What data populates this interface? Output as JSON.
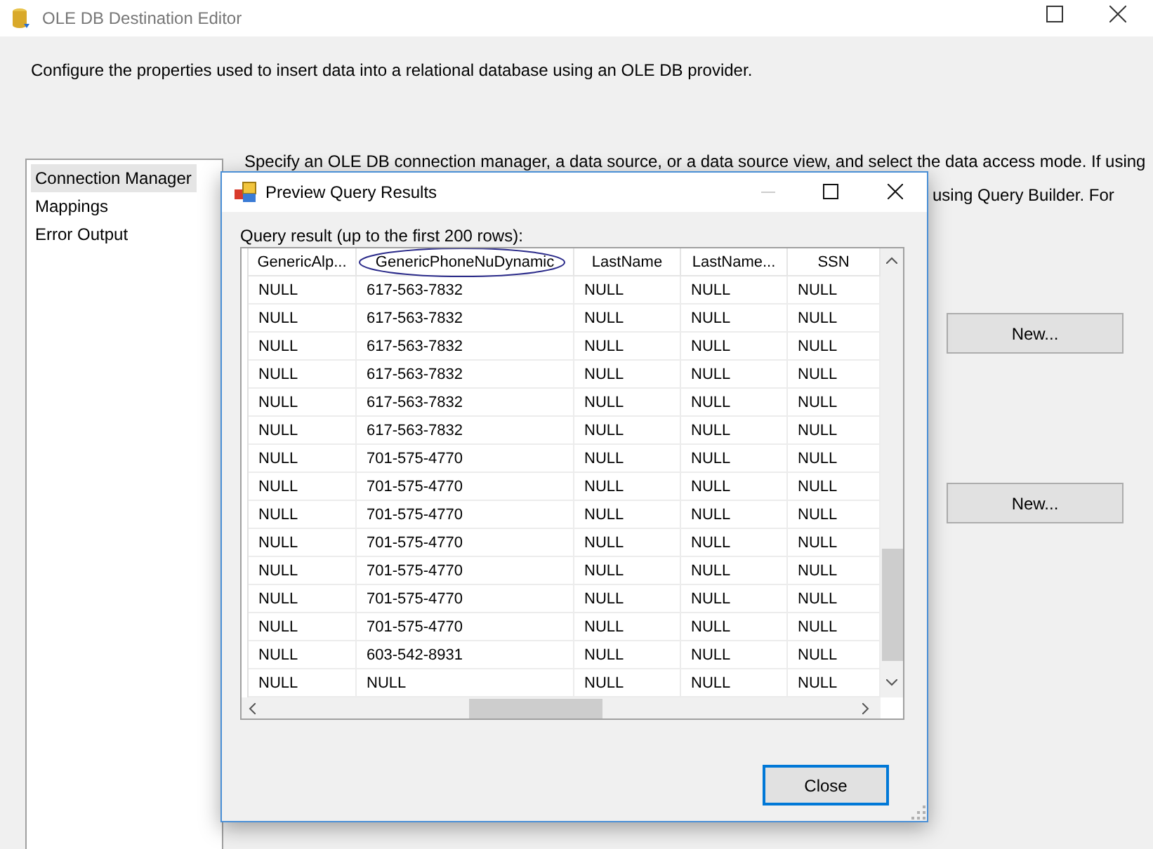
{
  "window": {
    "title": "OLE DB Destination Editor"
  },
  "description": "Configure the properties used to insert data into a relational database using an OLE DB provider.",
  "sidebar": {
    "items": [
      {
        "label": "Connection Manager",
        "selected": true
      },
      {
        "label": "Mappings",
        "selected": false
      },
      {
        "label": "Error Output",
        "selected": false
      }
    ]
  },
  "page_text": {
    "line_1": "Specify an OLE DB connection manager, a data source, or a data source view, and select the data access mode. If using",
    "line_2": "using Query Builder. For"
  },
  "buttons": [
    "New...",
    "New..."
  ],
  "dialog": {
    "title": "Preview Query Results",
    "label": "Query result (up to the first 200 rows):",
    "table": {
      "columns": [
        "GenericAlp...",
        "GenericPhoneNuDynamic",
        "LastName",
        "LastName...",
        "SSN"
      ],
      "rows": [
        [
          "NULL",
          "617-563-7832",
          "NULL",
          "NULL",
          "NULL"
        ],
        [
          "NULL",
          "617-563-7832",
          "NULL",
          "NULL",
          "NULL"
        ],
        [
          "NULL",
          "617-563-7832",
          "NULL",
          "NULL",
          "NULL"
        ],
        [
          "NULL",
          "617-563-7832",
          "NULL",
          "NULL",
          "NULL"
        ],
        [
          "NULL",
          "617-563-7832",
          "NULL",
          "NULL",
          "NULL"
        ],
        [
          "NULL",
          "617-563-7832",
          "NULL",
          "NULL",
          "NULL"
        ],
        [
          "NULL",
          "701-575-4770",
          "NULL",
          "NULL",
          "NULL"
        ],
        [
          "NULL",
          "701-575-4770",
          "NULL",
          "NULL",
          "NULL"
        ],
        [
          "NULL",
          "701-575-4770",
          "NULL",
          "NULL",
          "NULL"
        ],
        [
          "NULL",
          "701-575-4770",
          "NULL",
          "NULL",
          "NULL"
        ],
        [
          "NULL",
          "701-575-4770",
          "NULL",
          "NULL",
          "NULL"
        ],
        [
          "NULL",
          "701-575-4770",
          "NULL",
          "NULL",
          "NULL"
        ],
        [
          "NULL",
          "701-575-4770",
          "NULL",
          "NULL",
          "NULL"
        ],
        [
          "NULL",
          "603-542-8931",
          "NULL",
          "NULL",
          "NULL"
        ],
        [
          "NULL",
          "NULL",
          "NULL",
          "NULL",
          "NULL"
        ]
      ]
    },
    "close_button": "Close"
  }
}
